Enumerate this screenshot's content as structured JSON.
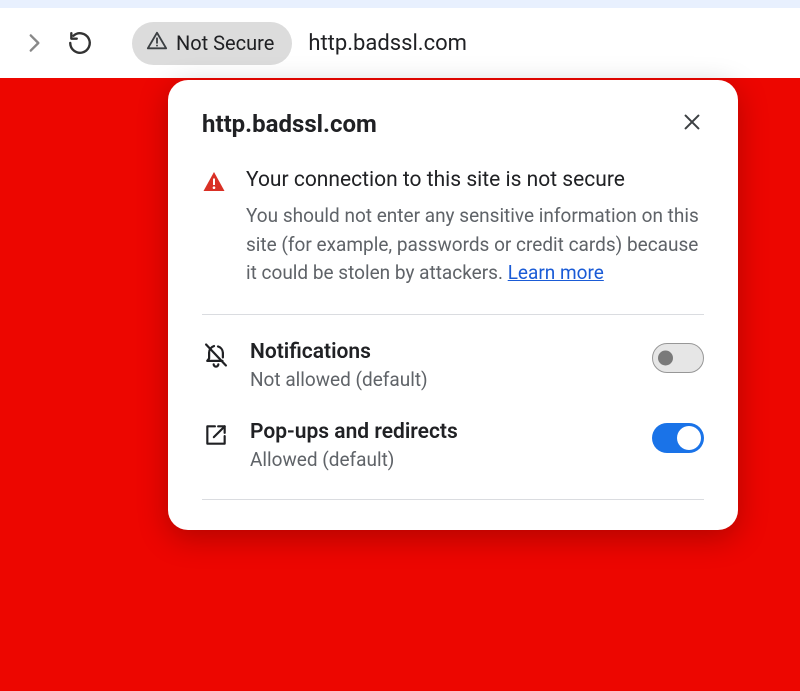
{
  "toolbar": {
    "not_secure_label": "Not Secure",
    "url": "http.badssl.com"
  },
  "popover": {
    "title": "http.badssl.com",
    "security": {
      "heading": "Your connection to this site is not secure",
      "body": "You should not enter any sensitive information on this site (for example, passwords or credit cards) because it could be stolen by attackers. ",
      "learn_more": "Learn more"
    },
    "permissions": [
      {
        "label": "Notifications",
        "status": "Not allowed (default)",
        "enabled": false
      },
      {
        "label": "Pop-ups and redirects",
        "status": "Allowed (default)",
        "enabled": true
      }
    ]
  }
}
